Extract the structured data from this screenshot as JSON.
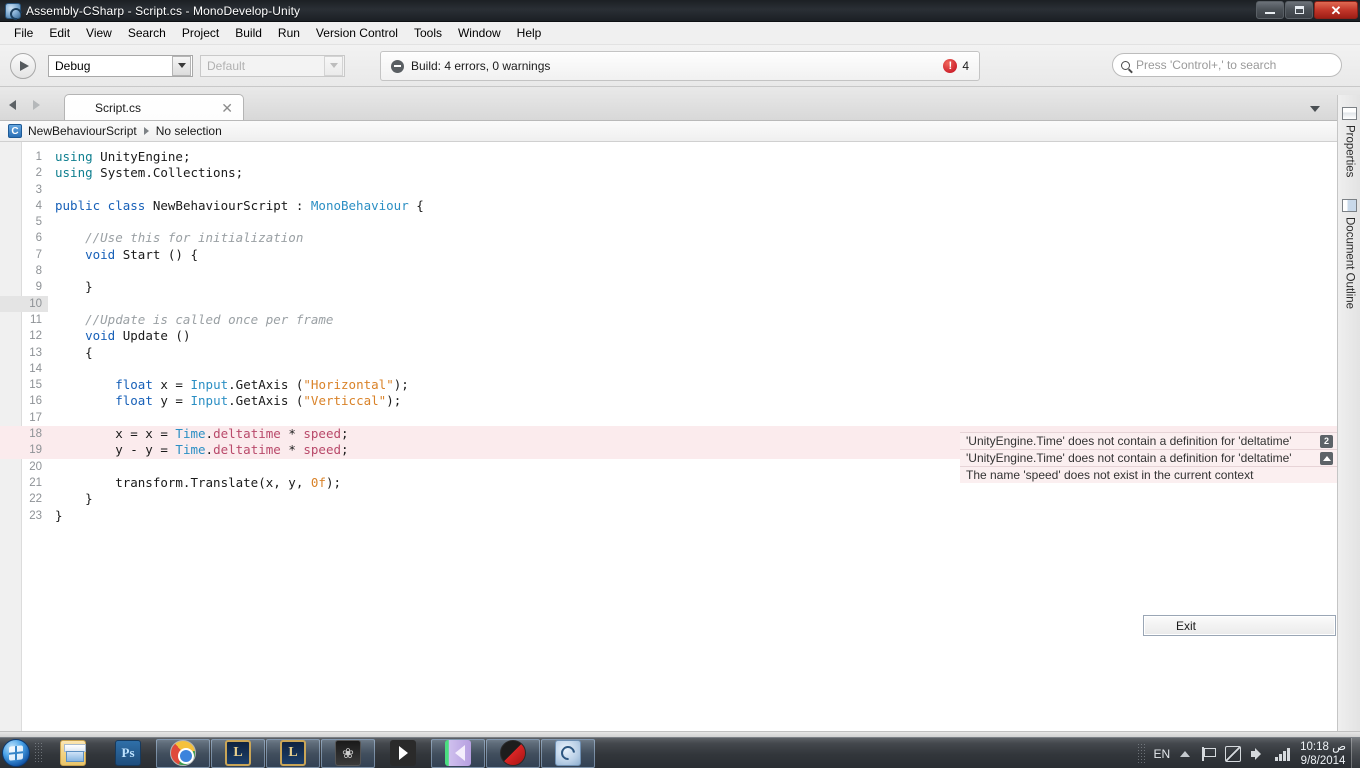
{
  "window": {
    "title": "Assembly-CSharp - Script.cs - MonoDevelop-Unity",
    "app_icon": "monodevelop-icon",
    "minimize_label": "Minimize",
    "maximize_label": "Restore",
    "close_label": "Close"
  },
  "menubar": {
    "items": [
      {
        "label": "File"
      },
      {
        "label": "Edit"
      },
      {
        "label": "View"
      },
      {
        "label": "Search"
      },
      {
        "label": "Project"
      },
      {
        "label": "Build"
      },
      {
        "label": "Run"
      },
      {
        "label": "Version Control"
      },
      {
        "label": "Tools"
      },
      {
        "label": "Window"
      },
      {
        "label": "Help"
      }
    ]
  },
  "toolbar": {
    "run_icon": "play-icon",
    "configuration": {
      "value": "Debug",
      "icon": "chevron-down-icon"
    },
    "platform": {
      "value": "Default",
      "icon": "chevron-down-icon",
      "disabled": true
    },
    "build_status": {
      "icon": "error-circle-icon",
      "text": "Build: 4 errors, 0 warnings",
      "badge_icon": "error-badge-icon",
      "badge_count": "4"
    },
    "search": {
      "icon": "search-icon",
      "placeholder": "Press 'Control+,' to search",
      "value": ""
    }
  },
  "tabbar": {
    "back_icon": "arrow-left-icon",
    "forward_icon": "arrow-right-icon",
    "tabs": [
      {
        "label": "Script.cs",
        "close_icon": "close-icon",
        "active": true
      }
    ],
    "overflow_icon": "chevron-down-icon"
  },
  "breadcrumb": {
    "class_icon": "csharp-class-icon",
    "class_name": "NewBehaviourScript",
    "separator_icon": "chevron-right-icon",
    "member": "No selection"
  },
  "editor": {
    "language": "csharp",
    "lines": [
      {
        "n": "1",
        "error": false,
        "tokens": [
          {
            "t": "using",
            "c": "kw"
          },
          {
            "t": " UnityEngine;",
            "c": "pln"
          }
        ]
      },
      {
        "n": "2",
        "error": false,
        "tokens": [
          {
            "t": "using",
            "c": "kw"
          },
          {
            "t": " System.Collections;",
            "c": "pln"
          }
        ]
      },
      {
        "n": "3",
        "error": false,
        "tokens": []
      },
      {
        "n": "4",
        "error": false,
        "tokens": [
          {
            "t": "public class",
            "c": "kw2"
          },
          {
            "t": " NewBehaviourScript : ",
            "c": "pln"
          },
          {
            "t": "MonoBehaviour",
            "c": "typ"
          },
          {
            "t": " {",
            "c": "pln"
          }
        ]
      },
      {
        "n": "5",
        "error": false,
        "tokens": []
      },
      {
        "n": "6",
        "error": false,
        "tokens": [
          {
            "t": "    //Use this for initialization",
            "c": "cmt"
          }
        ]
      },
      {
        "n": "7",
        "error": false,
        "tokens": [
          {
            "t": "    ",
            "c": "pln"
          },
          {
            "t": "void",
            "c": "kw2"
          },
          {
            "t": " Start () {",
            "c": "pln"
          }
        ]
      },
      {
        "n": "8",
        "error": false,
        "tokens": []
      },
      {
        "n": "9",
        "error": false,
        "tokens": [
          {
            "t": "    }",
            "c": "pln"
          }
        ]
      },
      {
        "n": "10",
        "error": false,
        "current": true,
        "tokens": []
      },
      {
        "n": "11",
        "error": false,
        "tokens": [
          {
            "t": "    //Update is called once per frame",
            "c": "cmt"
          }
        ]
      },
      {
        "n": "12",
        "error": false,
        "tokens": [
          {
            "t": "    ",
            "c": "pln"
          },
          {
            "t": "void",
            "c": "kw2"
          },
          {
            "t": " Update ()",
            "c": "pln"
          }
        ]
      },
      {
        "n": "13",
        "error": false,
        "tokens": [
          {
            "t": "    {",
            "c": "pln"
          }
        ]
      },
      {
        "n": "14",
        "error": false,
        "tokens": []
      },
      {
        "n": "15",
        "error": false,
        "tokens": [
          {
            "t": "        ",
            "c": "pln"
          },
          {
            "t": "float",
            "c": "kw2"
          },
          {
            "t": " x = ",
            "c": "pln"
          },
          {
            "t": "Input",
            "c": "typ"
          },
          {
            "t": ".GetAxis (",
            "c": "pln"
          },
          {
            "t": "\"Horizontal\"",
            "c": "str"
          },
          {
            "t": ");",
            "c": "pln"
          }
        ]
      },
      {
        "n": "16",
        "error": false,
        "tokens": [
          {
            "t": "        ",
            "c": "pln"
          },
          {
            "t": "float",
            "c": "kw2"
          },
          {
            "t": " y = ",
            "c": "pln"
          },
          {
            "t": "Input",
            "c": "typ"
          },
          {
            "t": ".GetAxis (",
            "c": "pln"
          },
          {
            "t": "\"Verticcal\"",
            "c": "str"
          },
          {
            "t": ");",
            "c": "pln"
          }
        ]
      },
      {
        "n": "17",
        "error": false,
        "tokens": []
      },
      {
        "n": "18",
        "error": true,
        "tokens": [
          {
            "t": "        x = x = ",
            "c": "pln"
          },
          {
            "t": "Time",
            "c": "typ"
          },
          {
            "t": ".",
            "c": "pln"
          },
          {
            "t": "deltatime",
            "c": "mbr"
          },
          {
            "t": " * ",
            "c": "pln"
          },
          {
            "t": "speed",
            "c": "mbr"
          },
          {
            "t": ";",
            "c": "pln"
          }
        ]
      },
      {
        "n": "19",
        "error": true,
        "tokens": [
          {
            "t": "        y - y = ",
            "c": "pln"
          },
          {
            "t": "Time",
            "c": "typ"
          },
          {
            "t": ".",
            "c": "pln"
          },
          {
            "t": "deltatime",
            "c": "mbr"
          },
          {
            "t": " * ",
            "c": "pln"
          },
          {
            "t": "speed",
            "c": "mbr"
          },
          {
            "t": ";",
            "c": "pln"
          }
        ]
      },
      {
        "n": "20",
        "error": false,
        "tokens": []
      },
      {
        "n": "21",
        "error": false,
        "tokens": [
          {
            "t": "        transform.Translate(x, y, ",
            "c": "pln"
          },
          {
            "t": "0f",
            "c": "num"
          },
          {
            "t": ");",
            "c": "pln"
          }
        ]
      },
      {
        "n": "22",
        "error": false,
        "tokens": [
          {
            "t": "    }",
            "c": "pln"
          }
        ]
      },
      {
        "n": "23",
        "error": false,
        "tokens": [
          {
            "t": "}",
            "c": "pln"
          }
        ]
      }
    ]
  },
  "error_tooltips": [
    {
      "message": "'UnityEngine.Time' does not contain a definition for 'deltatime'",
      "chip": "2",
      "chip_kind": "count"
    },
    {
      "message": "'UnityEngine.Time' does not contain a definition for 'deltatime'",
      "chip": "",
      "chip_kind": "triangle-up"
    },
    {
      "message": "The name 'speed' does not exist in the current context",
      "chip": "",
      "chip_kind": "none"
    }
  ],
  "exit_button": {
    "label": "Exit"
  },
  "right_dock": {
    "items": [
      {
        "label": "Properties",
        "icon": "properties-panel-icon"
      },
      {
        "label": "Document Outline",
        "icon": "document-outline-icon"
      }
    ]
  },
  "taskbar": {
    "start_icon": "windows-start-orb",
    "buttons": [
      {
        "icon": "file-explorer-icon",
        "name": "taskbar-explorer",
        "active": false
      },
      {
        "icon": "photoshop-icon",
        "name": "taskbar-photoshop",
        "active": false,
        "label": "Ps"
      },
      {
        "icon": "chrome-icon",
        "name": "taskbar-chrome",
        "active": true
      },
      {
        "icon": "league-of-legends-icon",
        "name": "taskbar-lol-1",
        "active": true,
        "label": "L"
      },
      {
        "icon": "league-of-legends-icon",
        "name": "taskbar-lol-2",
        "active": true,
        "label": "L"
      },
      {
        "icon": "pvz-icon",
        "name": "taskbar-game",
        "active": true,
        "label": "❀"
      },
      {
        "icon": "unity-icon",
        "name": "taskbar-unity",
        "active": true
      },
      {
        "icon": "monodevelop-splash-icon",
        "name": "taskbar-mono",
        "active": true
      },
      {
        "icon": "recorder-icon",
        "name": "taskbar-recorder",
        "active": true
      },
      {
        "icon": "monodevelop-icon",
        "name": "taskbar-monodevelop",
        "active": true
      }
    ],
    "tray": {
      "language": "EN",
      "show_hidden_icon": "chevron-up-icon",
      "icons": [
        "action-center-icon",
        "network-icon",
        "volume-icon",
        "signal-icon"
      ],
      "clock_time": "10:18 ص",
      "clock_date": "9/8/2014",
      "show_desktop_label": "Show desktop"
    }
  }
}
